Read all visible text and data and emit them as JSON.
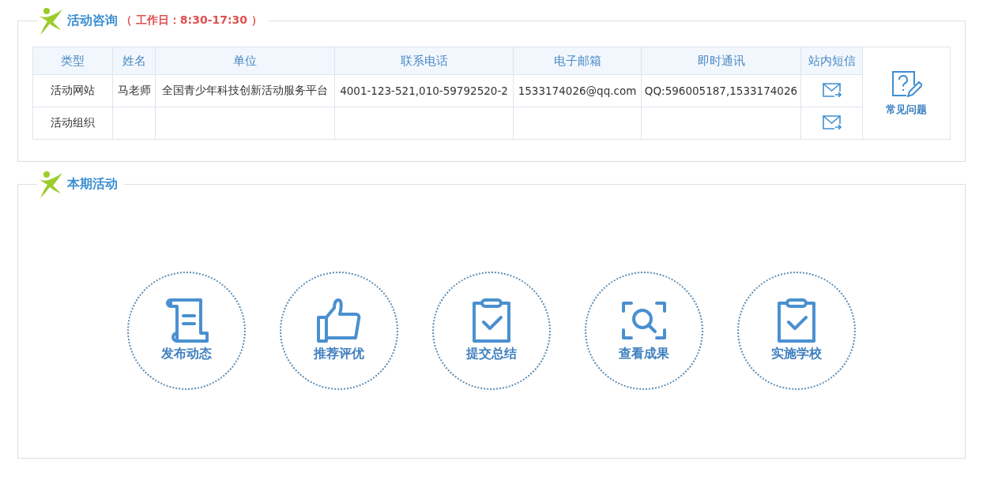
{
  "consult": {
    "title": "活动咨询",
    "hours": "（ 工作日：8:30-17:30 ）",
    "columns": [
      "类型",
      "姓名",
      "单位",
      "联系电话",
      "电子邮箱",
      "即时通讯",
      "站内短信"
    ],
    "rows": [
      {
        "cells": [
          "活动网站",
          "马老师",
          "全国青少年科技创新活动服务平台",
          "4001-123-521,010-59792520-2",
          "1533174026@qq.com",
          "QQ:596005187,1533174026"
        ]
      },
      {
        "cells": [
          "活动组织"
        ]
      }
    ],
    "faq": {
      "label": "常见问题"
    }
  },
  "activities": {
    "title": "本期活动",
    "items": [
      {
        "label": "发布动态",
        "kind": "scroll"
      },
      {
        "label": "推荐评优",
        "kind": "thumb"
      },
      {
        "label": "提交总结",
        "kind": "clipboard"
      },
      {
        "label": "查看成果",
        "kind": "scan"
      },
      {
        "label": "实施学校",
        "kind": "clipboard"
      }
    ]
  }
}
